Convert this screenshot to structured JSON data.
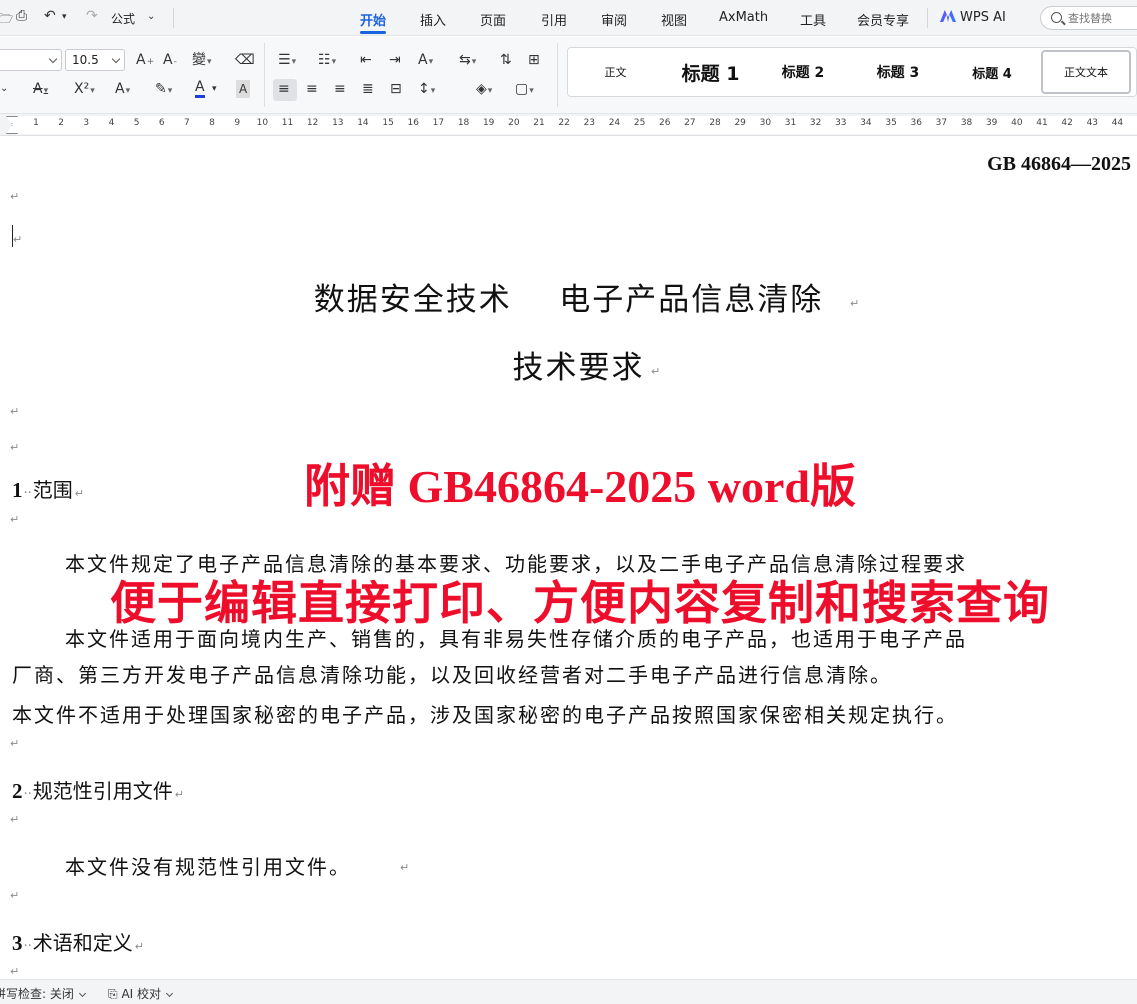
{
  "menubar": {
    "formula_label": "公式",
    "tabs": [
      "开始",
      "插入",
      "页面",
      "引用",
      "审阅",
      "视图",
      "AxMath",
      "工具",
      "会员专享"
    ],
    "wps_ai_label": "WPS AI",
    "search_placeholder": "查找替换"
  },
  "ribbon": {
    "font_size": "10.5",
    "styles": [
      "正文",
      "标题 1",
      "标题 2",
      "标题 3",
      "标题 4",
      "正文文本"
    ]
  },
  "ruler": {
    "numbers": [
      "1",
      "2",
      "3",
      "4",
      "5",
      "6",
      "7",
      "8",
      "9",
      "10",
      "11",
      "12",
      "13",
      "14",
      "15",
      "16",
      "17",
      "18",
      "19",
      "20",
      "21",
      "22",
      "23",
      "24",
      "25",
      "26",
      "27",
      "28",
      "29",
      "30",
      "31",
      "32",
      "33",
      "34",
      "35",
      "36",
      "37",
      "38",
      "39",
      "40",
      "41",
      "42",
      "43",
      "44"
    ]
  },
  "document": {
    "header": "GB 46864—2025",
    "title_line1": "数据安全技术    电子产品信息清除",
    "title_line2": "技术要求",
    "section1": {
      "number": "1",
      "title": "范围"
    },
    "section1_para1": "本文件规定了电子产品信息清除的基本要求、功能要求，以及二手电子产品信息清除过程要求",
    "section1_para2_line1": "本文件适用于面向境内生产、销售的，具有非易失性存储介质的电子产品，也适用于电子产品",
    "section1_para2_line2": "厂商、第三方开发电子产品信息清除功能，以及回收经营者对二手电子产品进行信息清除。",
    "section1_para3": "本文件不适用于处理国家秘密的电子产品，涉及国家秘密的电子产品按照国家保密相关规定执行。",
    "section2": {
      "number": "2",
      "title": "规范性引用文件"
    },
    "section2_para1": "本文件没有规范性引用文件。",
    "section3": {
      "number": "3",
      "title": "术语和定义"
    }
  },
  "promo": {
    "line1": "附赠 GB46864-2025 word版",
    "line2": "便于编辑直接打印、方便内容复制和搜索查询",
    "color": "#ee0d2a"
  },
  "statusbar": {
    "spellcheck": "拼写检查: 关闭",
    "ai_proofread": "AI 校对"
  },
  "colors": {
    "accent": "#1b62e0"
  }
}
